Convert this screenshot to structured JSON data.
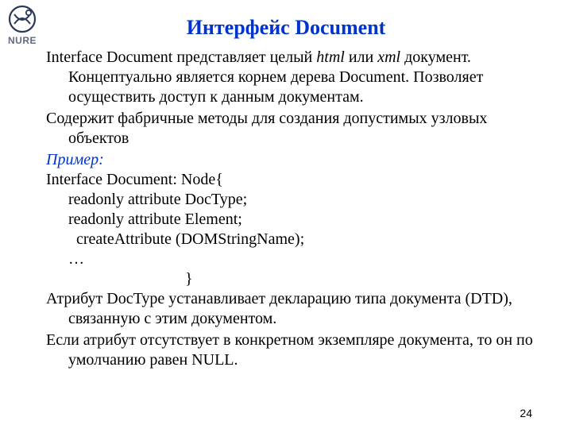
{
  "logo": {
    "text": "NURE"
  },
  "title": "Интерфейс Document",
  "para1_a": "Interface Document представляет целый ",
  "para1_b": "html",
  "para1_c": " или ",
  "para1_d": "xml",
  "para1_e": " документ. Концептуально является корнем дерева Document. Позволяет осуществить доступ к данным документам.",
  "para2": "Содержит фабричные методы для создания допустимых узловых объектов",
  "example_label": "Пример:",
  "code": {
    "l1": "Interface Document: Node{",
    "l2": "readonly attribute DocType;",
    "l3": "readonly attribute Element;",
    "l4": "createAttribute (DOMStringName);",
    "l5": "…",
    "l6": "}"
  },
  "para3": "Атрибут DocType устанавливает декларацию типа документа (DTD), связанную с этим документом.",
  "para4": "Если атрибут отсутствует в конкретном экземпляре документа, то он по умолчанию равен NULL.",
  "page_number": "24"
}
